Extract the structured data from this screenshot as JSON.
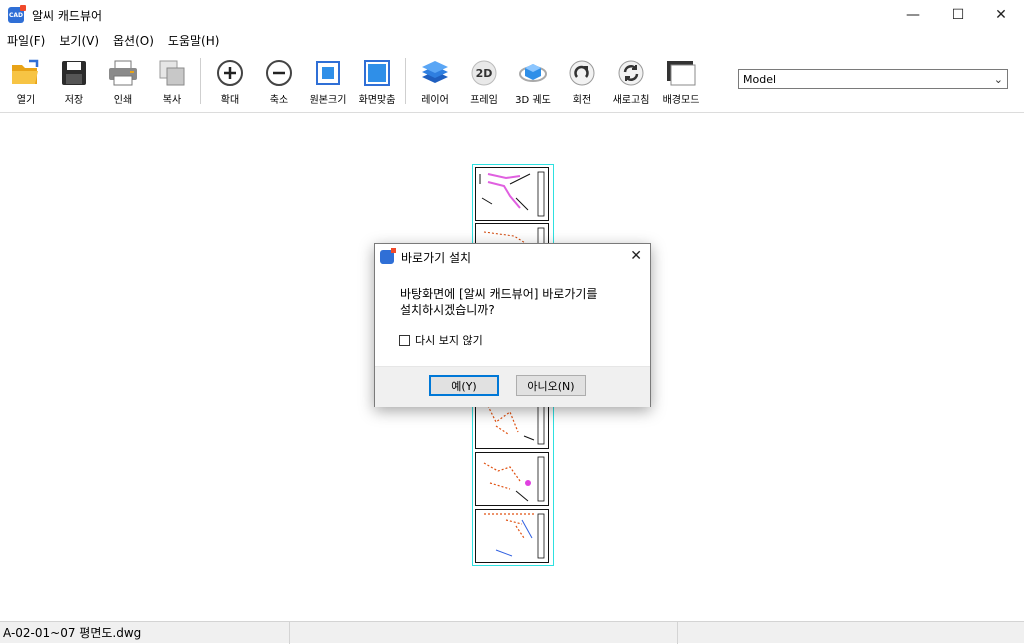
{
  "window": {
    "title": "알씨 캐드뷰어",
    "controls": {
      "minimize": "—",
      "maximize": "☐",
      "close": "✕"
    }
  },
  "menu": [
    {
      "label": "파일(F)"
    },
    {
      "label": "보기(V)"
    },
    {
      "label": "옵션(O)"
    },
    {
      "label": "도움말(H)"
    }
  ],
  "toolbar": {
    "buttons": [
      {
        "label": "열기",
        "icon": "folder-open-icon"
      },
      {
        "label": "저장",
        "icon": "floppy-disk-icon"
      },
      {
        "label": "인쇄",
        "icon": "printer-icon"
      },
      {
        "label": "복사",
        "icon": "copy-icon"
      },
      {
        "label": "확대",
        "icon": "zoom-in-icon"
      },
      {
        "label": "축소",
        "icon": "zoom-out-icon"
      },
      {
        "label": "원본크기",
        "icon": "original-size-icon"
      },
      {
        "label": "화면맞춤",
        "icon": "fit-screen-icon"
      },
      {
        "label": "레이어",
        "icon": "layers-icon"
      },
      {
        "label": "프레임",
        "icon": "frame-2d-icon",
        "glyph": "2D"
      },
      {
        "label": "3D 궤도",
        "icon": "orbit-3d-icon"
      },
      {
        "label": "회전",
        "icon": "rotate-icon"
      },
      {
        "label": "새로고침",
        "icon": "refresh-icon"
      },
      {
        "label": "배경모드",
        "icon": "background-mode-icon"
      }
    ],
    "layout_select": {
      "value": "Model",
      "chevron": "⌄"
    }
  },
  "dialog": {
    "title": "바로가기 설치",
    "close": "✕",
    "message_line1": "바탕화면에 [알씨 캐드뷰어] 바로가기를",
    "message_line2": "설치하시겠습니까?",
    "checkbox_label": "다시 보지 않기",
    "checkbox_checked": false,
    "yes_label": "예(Y)",
    "no_label": "아니오(N)"
  },
  "status": {
    "filename": "A-02-01~07 평면도.dwg"
  },
  "colors": {
    "accent": "#0078d7",
    "drawing_border": "#2ee0e0",
    "app_icon_blue": "#2f6fd6",
    "app_icon_red": "#f04a2b"
  }
}
